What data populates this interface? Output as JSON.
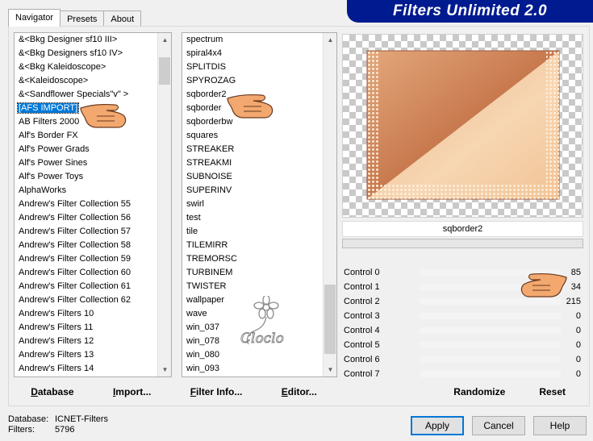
{
  "tabs": [
    "Navigator",
    "Presets",
    "About"
  ],
  "app_title": "Filters Unlimited 2.0",
  "categories": {
    "items": [
      "&<Bkg Designer sf10 III>",
      "&<Bkg Designers sf10 IV>",
      "&<Bkg Kaleidoscope>",
      "&<Kaleidoscope>",
      "&<Sandflower Specials\"v\" >",
      "[AFS IMPORT]",
      "AB Filters 2000",
      "Alf's Border FX",
      "Alf's Power Grads",
      "Alf's Power Sines",
      "Alf's Power Toys",
      "AlphaWorks",
      "Andrew's Filter Collection 55",
      "Andrew's Filter Collection 56",
      "Andrew's Filter Collection 57",
      "Andrew's Filter Collection 58",
      "Andrew's Filter Collection 59",
      "Andrew's Filter Collection 60",
      "Andrew's Filter Collection 61",
      "Andrew's Filter Collection 62",
      "Andrew's Filters 10",
      "Andrew's Filters 11",
      "Andrew's Filters 12",
      "Andrew's Filters 13",
      "Andrew's Filters 14"
    ],
    "selected_index": 5
  },
  "filters": {
    "items": [
      "spectrum",
      "spiral4x4",
      "SPLITDIS",
      "SPYROZAG",
      "sqborder2",
      "sqborder",
      "sqborderbw",
      "squares",
      "STREAKER",
      "STREAKMI",
      "SUBNOISE",
      "SUPERINV",
      "swirl",
      "test",
      "tile",
      "TILEMIRR",
      "TREMORSC",
      "TURBINEM",
      "TWISTER",
      "wallpaper",
      "wave",
      "win_037",
      "win_078",
      "win_080",
      "win_093"
    ]
  },
  "watermark_text": "Cloclo",
  "selected_filter_name": "sqborder2",
  "progress": 0,
  "controls": [
    {
      "label": "Control 0",
      "value": "85"
    },
    {
      "label": "Control 1",
      "value": "34"
    },
    {
      "label": "Control 2",
      "value": "215"
    },
    {
      "label": "Control 3",
      "value": "0"
    },
    {
      "label": "Control 4",
      "value": "0"
    },
    {
      "label": "Control 5",
      "value": "0"
    },
    {
      "label": "Control 6",
      "value": "0"
    },
    {
      "label": "Control 7",
      "value": "0"
    }
  ],
  "buttons": {
    "database": {
      "first": "D",
      "rest": "atabase"
    },
    "import": {
      "first": "I",
      "rest": "mport..."
    },
    "filter_info": {
      "first": "F",
      "rest": "ilter Info..."
    },
    "editor": {
      "first": "E",
      "rest": "ditor..."
    },
    "randomize": "Randomize",
    "reset": "Reset",
    "apply": "Apply",
    "cancel": "Cancel",
    "help": "Help"
  },
  "status": {
    "database_label": "Database:",
    "database_value": "ICNET-Filters",
    "filters_label": "Filters:",
    "filters_value": "5796"
  },
  "colors": {
    "title_bar": "#001a8f",
    "selection": "#0078d7",
    "preview_dark": "#c8794e",
    "preview_light": "#f7d6b2"
  }
}
